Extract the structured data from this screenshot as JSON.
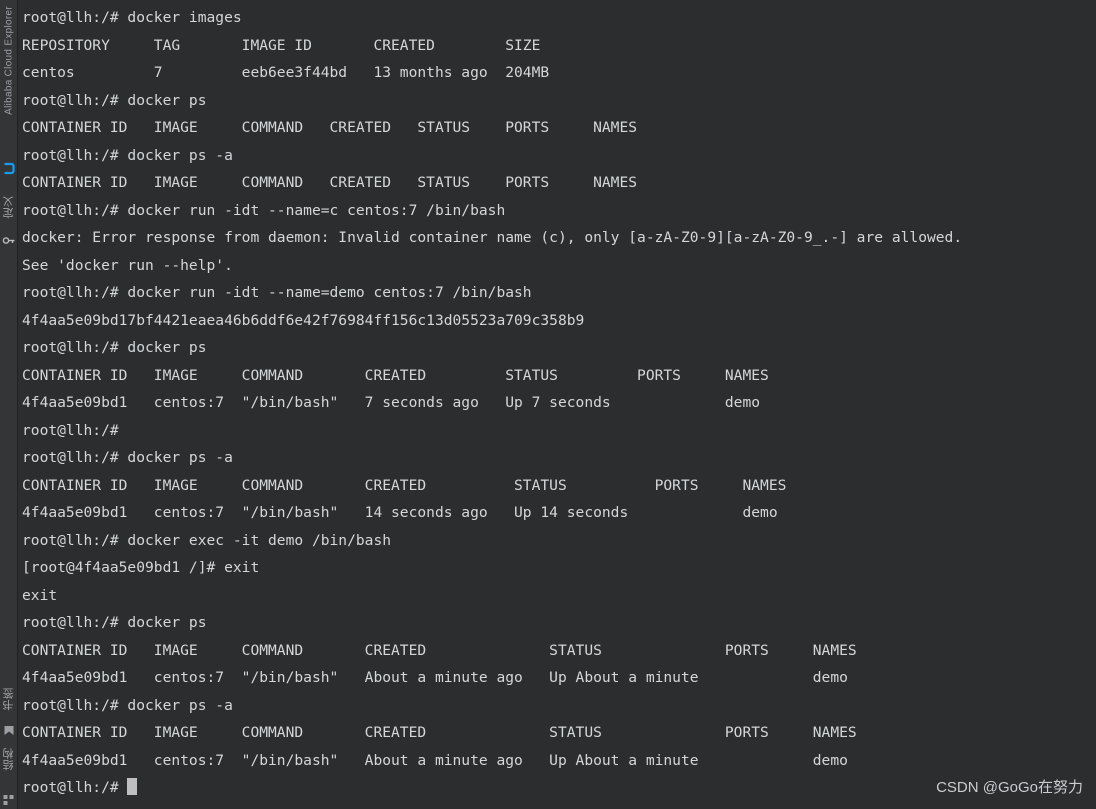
{
  "sidebar": {
    "explorer_label": "Alibaba Cloud Explorer",
    "items": [
      {
        "name": "alibaba-cloud-explorer",
        "label": "Alibaba Cloud Explorer"
      },
      {
        "name": "cloud-icon",
        "label": ""
      },
      {
        "name": "definition-panel",
        "label": "定义"
      },
      {
        "name": "bookmark-panel",
        "label": "书签"
      },
      {
        "name": "structure-panel",
        "label": "结构"
      }
    ]
  },
  "terminal": {
    "prompt": "root@llh:/# ",
    "cursor_visible": true,
    "lines": [
      "root@llh:/# docker images",
      "REPOSITORY     TAG       IMAGE ID       CREATED        SIZE",
      "centos         7         eeb6ee3f44bd   13 months ago  204MB",
      "root@llh:/# docker ps",
      "CONTAINER ID   IMAGE     COMMAND   CREATED   STATUS    PORTS     NAMES",
      "root@llh:/# docker ps -a",
      "CONTAINER ID   IMAGE     COMMAND   CREATED   STATUS    PORTS     NAMES",
      "root@llh:/# docker run -idt --name=c centos:7 /bin/bash",
      "docker: Error response from daemon: Invalid container name (c), only [a-zA-Z0-9][a-zA-Z0-9_.-] are allowed.",
      "See 'docker run --help'.",
      "root@llh:/# docker run -idt --name=demo centos:7 /bin/bash",
      "4f4aa5e09bd17bf4421eaea46b6ddf6e42f76984ff156c13d05523a709c358b9",
      "root@llh:/# docker ps",
      "CONTAINER ID   IMAGE     COMMAND       CREATED         STATUS         PORTS     NAMES",
      "4f4aa5e09bd1   centos:7  \"/bin/bash\"   7 seconds ago   Up 7 seconds             demo",
      "root@llh:/# ",
      "root@llh:/# docker ps -a",
      "CONTAINER ID   IMAGE     COMMAND       CREATED          STATUS          PORTS     NAMES",
      "4f4aa5e09bd1   centos:7  \"/bin/bash\"   14 seconds ago   Up 14 seconds             demo",
      "root@llh:/# docker exec -it demo /bin/bash",
      "[root@4f4aa5e09bd1 /]# exit",
      "exit",
      "root@llh:/# docker ps",
      "CONTAINER ID   IMAGE     COMMAND       CREATED              STATUS              PORTS     NAMES",
      "4f4aa5e09bd1   centos:7  \"/bin/bash\"   About a minute ago   Up About a minute             demo",
      "root@llh:/# docker ps -a",
      "CONTAINER ID   IMAGE     COMMAND       CREATED              STATUS              PORTS     NAMES",
      "4f4aa5e09bd1   centos:7  \"/bin/bash\"   About a minute ago   Up About a minute             demo"
    ],
    "last_prompt": "root@llh:/# "
  },
  "watermark": {
    "text": "CSDN @GoGo在努力"
  },
  "colors": {
    "background": "#2b2d2e",
    "sidebar": "#333537",
    "text": "#d3d7da",
    "accent": "#1a9bf0",
    "cursor": "#bfbfbf"
  }
}
